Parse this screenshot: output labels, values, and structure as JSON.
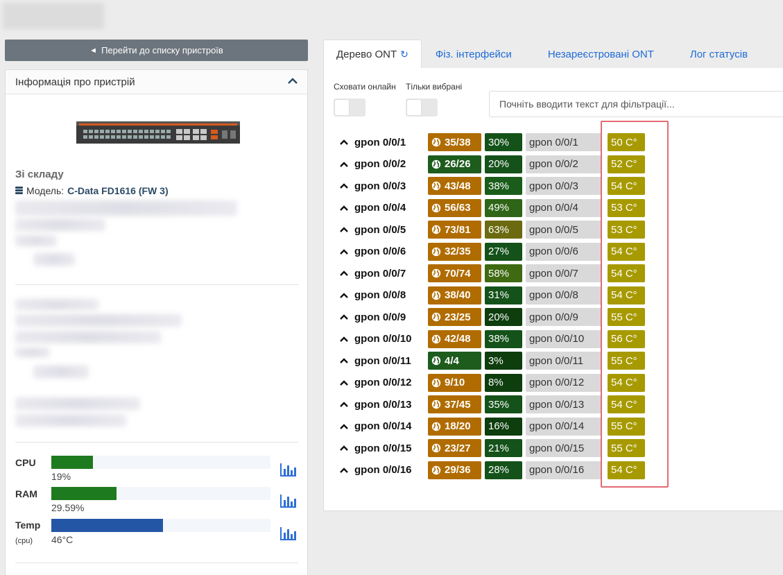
{
  "header": {
    "title_blurred": true
  },
  "back_button": {
    "icon": "arrow-left-icon",
    "label": "Перейти до списку пристроїв"
  },
  "device_card": {
    "title": "Інформація про пристрій",
    "collapse_icon": "chevron-up-icon",
    "stock_label": "Зі складу",
    "model_label": "Модель:",
    "model_value": "C-Data FD1616 (FW 3)",
    "metrics": [
      {
        "label": "CPU",
        "sub": "",
        "value": "19%",
        "fraction": 0.19,
        "color": "#1e7a1e"
      },
      {
        "label": "RAM",
        "sub": "",
        "value": "29.59%",
        "fraction": 0.2959,
        "color": "#1e7a1e"
      },
      {
        "label": "Temp",
        "sub": "(cpu)",
        "value": "46°C",
        "fraction": 0.51,
        "color": "#2456a6"
      }
    ]
  },
  "tabs": [
    {
      "label": "Дерево ONT",
      "active": true,
      "icon": "refresh-icon"
    },
    {
      "label": "Фіз. інтерфейси",
      "active": false
    },
    {
      "label": "Незареєстровані ONT",
      "active": false
    },
    {
      "label": "Лог статусів",
      "active": false
    }
  ],
  "filters": {
    "hide_online_label": "Сховати онлайн",
    "only_selected_label": "Тільки вибрані",
    "search_placeholder": "Почніть вводити текст для фільтрації..."
  },
  "colors": {
    "onu_orange": "#b06c00",
    "onu_green": "#1d5c1d",
    "pct_green": "#1c5c1c",
    "pct_dark": "#0e3d0e",
    "pct_olive": "#7a6a00",
    "temp": "#a79a00",
    "highlight": "#e46a73"
  },
  "ports": [
    {
      "name": "gpon 0/0/1",
      "onu": "35/38",
      "onu_color": "#b06c00",
      "pct": "30%",
      "pct_color": "#14521a",
      "port": "gpon 0/0/1",
      "temp": "50 C°"
    },
    {
      "name": "gpon 0/0/2",
      "onu": "26/26",
      "onu_color": "#1d5c1d",
      "pct": "20%",
      "pct_color": "#14521a",
      "port": "gpon 0/0/2",
      "temp": "52 C°"
    },
    {
      "name": "gpon 0/0/3",
      "onu": "43/48",
      "onu_color": "#b06c00",
      "pct": "38%",
      "pct_color": "#1a5c1a",
      "port": "gpon 0/0/3",
      "temp": "54 C°"
    },
    {
      "name": "gpon 0/0/4",
      "onu": "56/63",
      "onu_color": "#b06c00",
      "pct": "49%",
      "pct_color": "#2e6516",
      "port": "gpon 0/0/4",
      "temp": "53 C°"
    },
    {
      "name": "gpon 0/0/5",
      "onu": "73/81",
      "onu_color": "#b06c00",
      "pct": "63%",
      "pct_color": "#6b6a10",
      "port": "gpon 0/0/5",
      "temp": "53 C°"
    },
    {
      "name": "gpon 0/0/6",
      "onu": "32/35",
      "onu_color": "#b06c00",
      "pct": "27%",
      "pct_color": "#14521a",
      "port": "gpon 0/0/6",
      "temp": "54 C°"
    },
    {
      "name": "gpon 0/0/7",
      "onu": "70/74",
      "onu_color": "#b06c00",
      "pct": "58%",
      "pct_color": "#3f6a12",
      "port": "gpon 0/0/7",
      "temp": "54 C°"
    },
    {
      "name": "gpon 0/0/8",
      "onu": "38/40",
      "onu_color": "#b06c00",
      "pct": "31%",
      "pct_color": "#14521a",
      "port": "gpon 0/0/8",
      "temp": "54 C°"
    },
    {
      "name": "gpon 0/0/9",
      "onu": "23/25",
      "onu_color": "#b06c00",
      "pct": "20%",
      "pct_color": "#0e3d0e",
      "port": "gpon 0/0/9",
      "temp": "55 C°"
    },
    {
      "name": "gpon 0/0/10",
      "onu": "42/48",
      "onu_color": "#b06c00",
      "pct": "38%",
      "pct_color": "#14521a",
      "port": "gpon 0/0/10",
      "temp": "56 C°"
    },
    {
      "name": "gpon 0/0/11",
      "onu": "4/4",
      "onu_color": "#1d5c1d",
      "pct": "3%",
      "pct_color": "#0e3d0e",
      "port": "gpon 0/0/11",
      "temp": "55 C°"
    },
    {
      "name": "gpon 0/0/12",
      "onu": "9/10",
      "onu_color": "#b06c00",
      "pct": "8%",
      "pct_color": "#0e3d0e",
      "port": "gpon 0/0/12",
      "temp": "54 C°"
    },
    {
      "name": "gpon 0/0/13",
      "onu": "37/45",
      "onu_color": "#b06c00",
      "pct": "35%",
      "pct_color": "#14521a",
      "port": "gpon 0/0/13",
      "temp": "54 C°"
    },
    {
      "name": "gpon 0/0/14",
      "onu": "18/20",
      "onu_color": "#b06c00",
      "pct": "16%",
      "pct_color": "#0e3d0e",
      "port": "gpon 0/0/14",
      "temp": "55 C°"
    },
    {
      "name": "gpon 0/0/15",
      "onu": "23/27",
      "onu_color": "#b06c00",
      "pct": "21%",
      "pct_color": "#14521a",
      "port": "gpon 0/0/15",
      "temp": "55 C°"
    },
    {
      "name": "gpon 0/0/16",
      "onu": "29/36",
      "onu_color": "#b06c00",
      "pct": "28%",
      "pct_color": "#14521a",
      "port": "gpon 0/0/16",
      "temp": "54 C°"
    }
  ]
}
